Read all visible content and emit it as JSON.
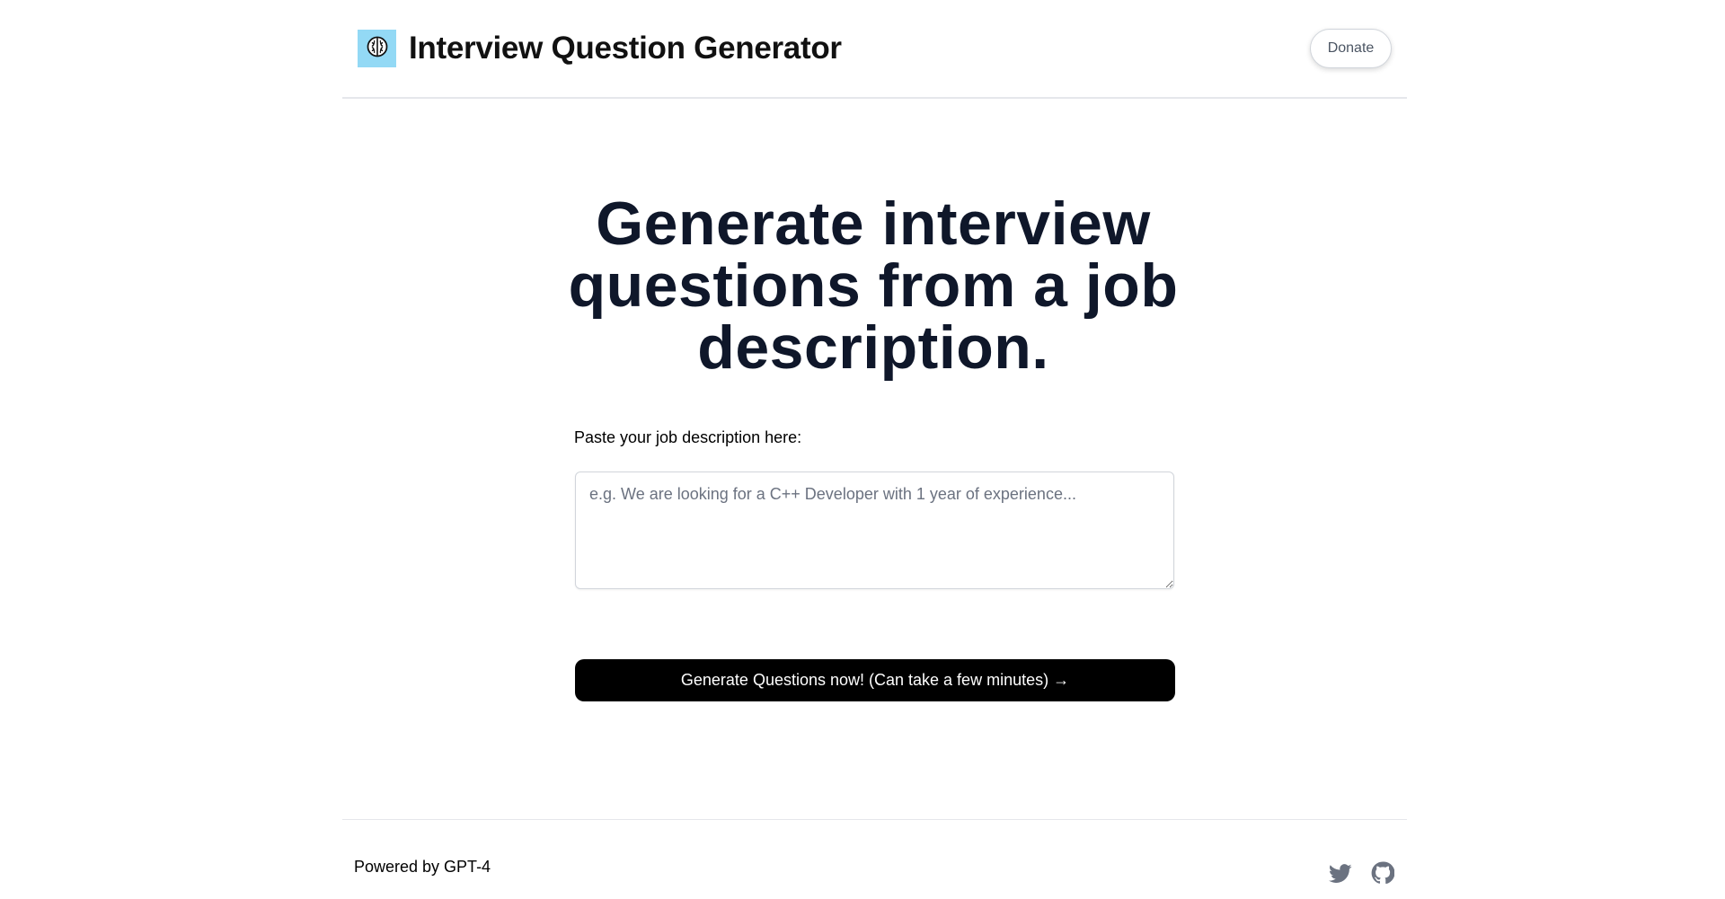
{
  "header": {
    "logo_icon": "brain-icon",
    "title": "Interview Question Generator",
    "donate_label": "Donate"
  },
  "main": {
    "headline": "Generate interview questions from a job description.",
    "input_label": "Paste your job description here:",
    "input_placeholder": "e.g. We are looking for a C++ Developer with 1 year of experience...",
    "input_value": "",
    "generate_label": "Generate Questions now! (Can take a few minutes) →"
  },
  "footer": {
    "powered_by": "Powered by GPT-4",
    "social_icons": [
      "twitter-icon",
      "github-icon"
    ]
  },
  "colors": {
    "logo_bg": "#93d9f5",
    "headline": "#0f172a",
    "button_bg": "#000000",
    "icon_gray": "#6b7280"
  }
}
